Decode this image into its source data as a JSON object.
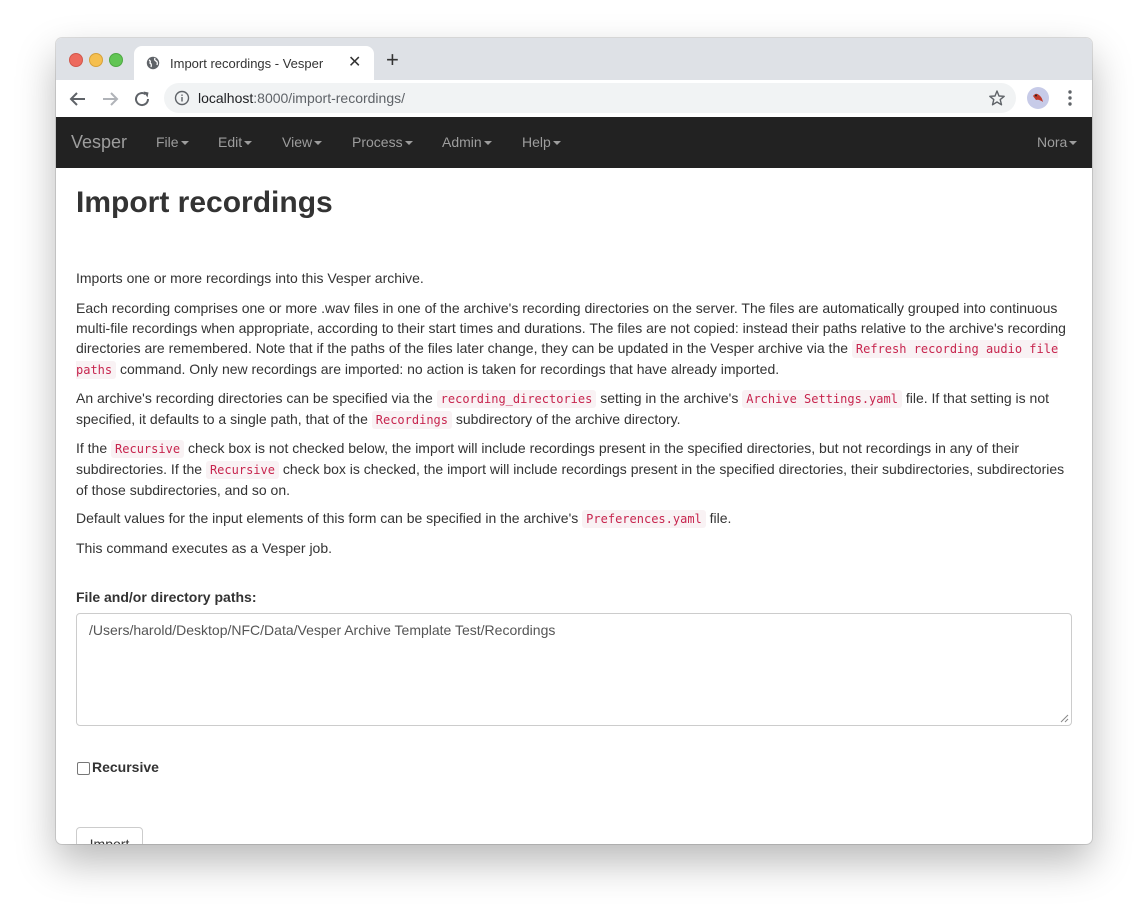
{
  "browser": {
    "tab_title": "Import recordings - Vesper",
    "close_glyph": "✕",
    "new_tab_glyph": "+",
    "url_host": "localhost",
    "url_path": ":8000/import-recordings/"
  },
  "navbar": {
    "brand": "Vesper",
    "menus": [
      "File",
      "Edit",
      "View",
      "Process",
      "Admin",
      "Help"
    ],
    "user": "Nora"
  },
  "page": {
    "title": "Import recordings",
    "intro": "Imports one or more recordings into this Vesper archive.",
    "p2": {
      "t1": "Each recording comprises one or more .wav files in one of the archive's recording directories on the server. The files are automatically grouped into continuous multi-file recordings when appropriate, according to their start times and durations. The files are not copied: instead their paths relative to the archive's recording directories are remembered. Note that if the paths of the files later change, they can be updated in the Vesper archive via the ",
      "c1": "Refresh recording audio file paths",
      "t2": " command. Only new recordings are imported: no action is taken for recordings that have already imported."
    },
    "p3": {
      "t1": "An archive's recording directories can be specified via the ",
      "c1": "recording_directories",
      "t2": " setting in the archive's ",
      "c2": "Archive Settings.yaml",
      "t3": " file. If that setting is not specified, it defaults to a single path, that of the ",
      "c3": "Recordings",
      "t4": " subdirectory of the archive directory."
    },
    "p4": {
      "t1": "If the ",
      "c1": "Recursive",
      "t2": " check box is not checked below, the import will include recordings present in the specified directories, but not recordings in any of their subdirectories. If the ",
      "c2": "Recursive",
      "t3": " check box is checked, the import will include recordings present in the specified directories, their subdirectories, subdirectories of those subdirectories, and so on."
    },
    "p5": {
      "t1": "Default values for the input elements of this form can be specified in the archive's ",
      "c1": "Preferences.yaml",
      "t2": " file."
    },
    "p6": "This command executes as a Vesper job."
  },
  "form": {
    "paths_label": "File and/or directory paths:",
    "paths_value": "/Users/harold/Desktop/NFC/Data/Vesper Archive Template Test/Recordings",
    "recursive_label": "Recursive",
    "recursive_checked": false,
    "import_button": "Import"
  },
  "colors": {
    "navbar_bg": "#222222",
    "navbar_text": "#9d9d9d",
    "code_text": "#c7254e",
    "code_bg": "#f9f2f4"
  }
}
